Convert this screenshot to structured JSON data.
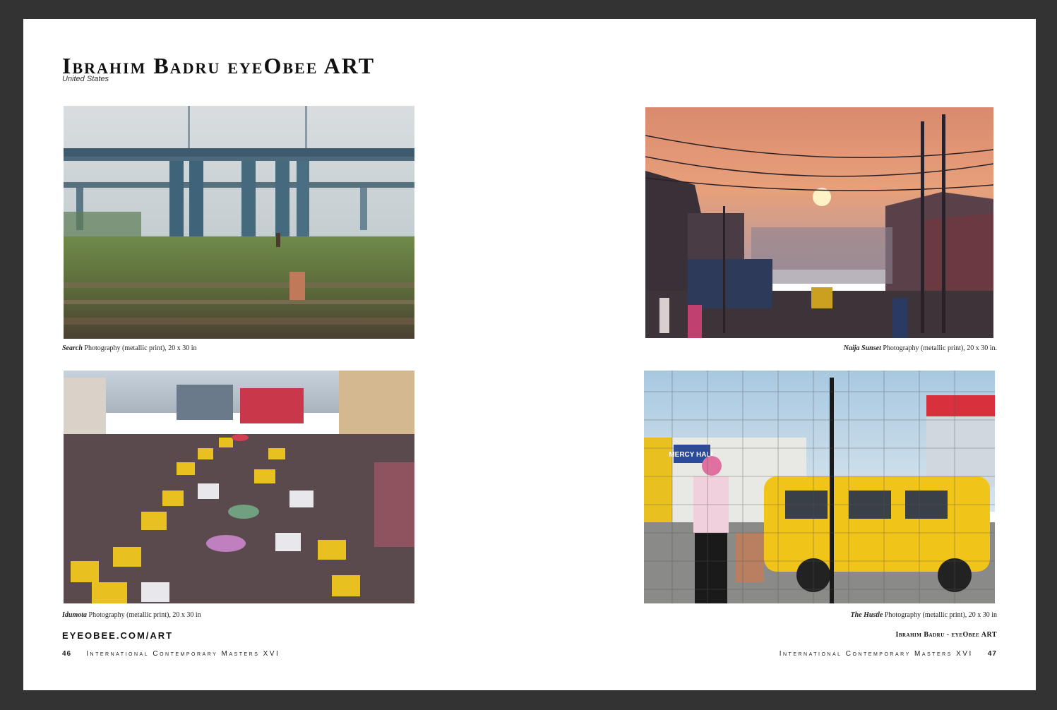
{
  "header": {
    "title": "Ibrahim Badru eyeObee ART",
    "country": "United States"
  },
  "photos": [
    {
      "title": "Search",
      "details": "Photography (metallic print), 20 x 30 in"
    },
    {
      "title": "Naija Sunset",
      "details": "Photography (metallic print), 20 x 30 in."
    },
    {
      "title": "Idumota",
      "details": "Photography (metallic print), 20 x 30 in"
    },
    {
      "title": "The Hustle",
      "details": "Photography (metallic print), 20 x 30 in"
    }
  ],
  "footer": {
    "website": "EYEOBEE.COM/ART",
    "artist_credit": "Ibrahim Badru - eyeObee ART",
    "left_page_number": "46",
    "right_page_number": "47",
    "publication": "International Contemporary Masters XVI"
  },
  "signage": {
    "mercy_hall": "MERCY HALL"
  }
}
